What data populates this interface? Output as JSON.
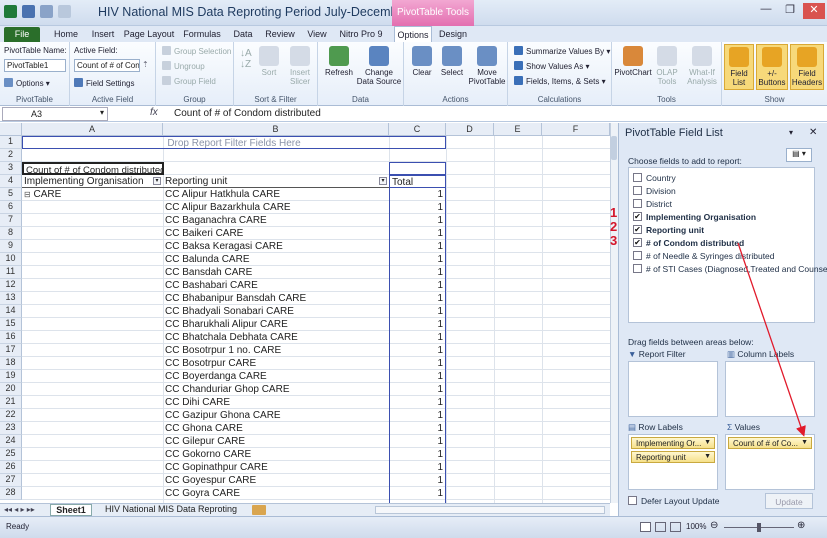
{
  "window": {
    "title": "HIV National MIS Data Reproting Period July-Decembe...",
    "context_tab": "PivotTable Tools",
    "controls": [
      "—",
      "❐",
      "✕"
    ]
  },
  "tabs": {
    "file": "File",
    "items": [
      "Home",
      "Insert",
      "Page Layout",
      "Formulas",
      "Data",
      "Review",
      "View",
      "Nitro Pro 9",
      "Options",
      "Design"
    ],
    "active": "Options"
  },
  "ribbon": {
    "pivottable": {
      "name_label": "PivotTable Name:",
      "name_value": "PivotTable1",
      "options": "Options",
      "group": "PivotTable"
    },
    "active_field": {
      "label": "Active Field:",
      "value": "Count of # of Con",
      "settings": "Field Settings",
      "group": "Active Field"
    },
    "group": {
      "selection": "Group Selection",
      "ungroup": "Ungroup",
      "field": "Group Field",
      "group": "Group"
    },
    "sort": {
      "sort": "Sort",
      "insert_slicer": "Insert Slicer",
      "group": "Sort & Filter"
    },
    "data": {
      "refresh": "Refresh",
      "change_source": "Change Data Source",
      "group": "Data"
    },
    "actions": {
      "clear": "Clear",
      "select": "Select",
      "move": "Move PivotTable",
      "group": "Actions"
    },
    "calculations": {
      "summarize": "Summarize Values By",
      "show_as": "Show Values As",
      "fields": "Fields, Items, & Sets",
      "group": "Calculations"
    },
    "tools": {
      "chart": "PivotChart",
      "olap": "OLAP Tools",
      "whatif": "What-If Analysis",
      "group": "Tools"
    },
    "show": {
      "field_list": "Field List",
      "buttons": "+/- Buttons",
      "headers": "Field Headers",
      "group": "Show"
    }
  },
  "formula_bar": {
    "name_box": "A3",
    "fx": "fx",
    "formula": "Count of # of Condom distributed"
  },
  "grid": {
    "columns": [
      "A",
      "B",
      "C",
      "D",
      "E",
      "F"
    ],
    "drop_zone": "Drop Report Filter Fields Here",
    "pivot_title": "Count of # of Condom distributed",
    "header_a": "Implementing Organisation",
    "header_b": "Reporting unit",
    "header_c": "Total",
    "org": "CARE",
    "org_toggle": "⊟",
    "rows": [
      "CC Alipur Hatkhula CARE",
      "CC Alipur Bazarkhula CARE",
      "CC Baganachra CARE",
      "CC Baikeri CARE",
      "CC Baksa Keragasi CARE",
      "CC Balunda CARE",
      "CC Bansdah CARE",
      "CC Bashabari CARE",
      "CC Bhabanipur Bansdah CARE",
      "CC Bhadyali Sonabari CARE",
      "CC Bharukhali Alipur CARE",
      "CC Bhatchala Debhata CARE",
      "CC Bosotrpur 1 no. CARE",
      "CC Bosotrpur CARE",
      "CC Boyerdanga CARE",
      "CC Chanduriar Ghop CARE",
      "CC Dihi CARE",
      "CC Gazipur Ghona CARE",
      "CC Ghona CARE",
      "CC Gilepur CARE",
      "CC Gokorno CARE",
      "CC Gopinathpur CARE",
      "CC Goyespur CARE",
      "CC Goyra CARE"
    ],
    "values": [
      "1",
      "1",
      "1",
      "1",
      "1",
      "1",
      "1",
      "1",
      "1",
      "1",
      "1",
      "1",
      "1",
      "1",
      "1",
      "1",
      "1",
      "1",
      "1",
      "1",
      "1",
      "1",
      "1",
      "1"
    ],
    "row_numbers": [
      "1",
      "2",
      "3",
      "4",
      "5",
      "6",
      "7",
      "8",
      "9",
      "10",
      "11",
      "12",
      "13",
      "14",
      "15",
      "16",
      "17",
      "18",
      "19",
      "20",
      "21",
      "22",
      "23",
      "24",
      "25",
      "26",
      "27",
      "28"
    ]
  },
  "sheet_tabs": {
    "active": "Sheet1",
    "other": "HIV National MIS Data Reproting"
  },
  "status": {
    "ready": "Ready",
    "zoom": "100%"
  },
  "field_list": {
    "title": "PivotTable Field List",
    "choose": "Choose fields to add to report:",
    "fields": [
      {
        "label": "Country",
        "checked": false,
        "bold": false
      },
      {
        "label": "Division",
        "checked": false,
        "bold": false
      },
      {
        "label": "District",
        "checked": false,
        "bold": false
      },
      {
        "label": "Implementing Organisation",
        "checked": true,
        "bold": true
      },
      {
        "label": "Reporting unit",
        "checked": true,
        "bold": true
      },
      {
        "label": "# of Condom distributed",
        "checked": true,
        "bold": true
      },
      {
        "label": "# of Needle & Syringes distributed",
        "checked": false,
        "bold": false
      },
      {
        "label": "# of STI Cases (Diagnosed,Treated and Counsel...",
        "checked": false,
        "bold": false
      }
    ],
    "annotations": [
      "1",
      "2",
      "3"
    ],
    "drag_label": "Drag fields between areas below:",
    "report_filter": "Report Filter",
    "column_labels": "Column Labels",
    "row_labels": "Row Labels",
    "values": "Values",
    "row_fields": [
      "Implementing Or...",
      "Reporting unit"
    ],
    "value_fields": [
      "Count of # of Co..."
    ],
    "defer": "Defer Layout Update",
    "update": "Update"
  },
  "colors": {
    "accent": "#2a6e2a",
    "context": "#e36fb0",
    "annotation": "#d4152b"
  }
}
